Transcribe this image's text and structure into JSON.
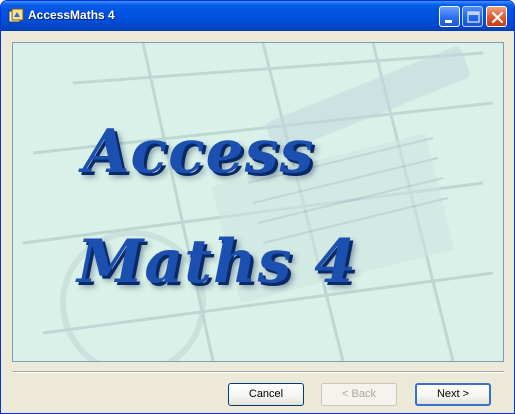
{
  "window": {
    "title": "AccessMaths 4",
    "title_bar_color": "#0054e3",
    "close_button_color": "#e2582a"
  },
  "splash": {
    "line1": "Access",
    "line2": "Maths 4",
    "background_color": "#d8f0e6",
    "logo_color": "#1b4fb0"
  },
  "buttons": {
    "cancel": "Cancel",
    "back": "< Back",
    "next": "Next >"
  },
  "icons": {
    "app": "app-icon",
    "minimize": "minimize-icon",
    "maximize": "maximize-icon",
    "close": "close-icon"
  }
}
